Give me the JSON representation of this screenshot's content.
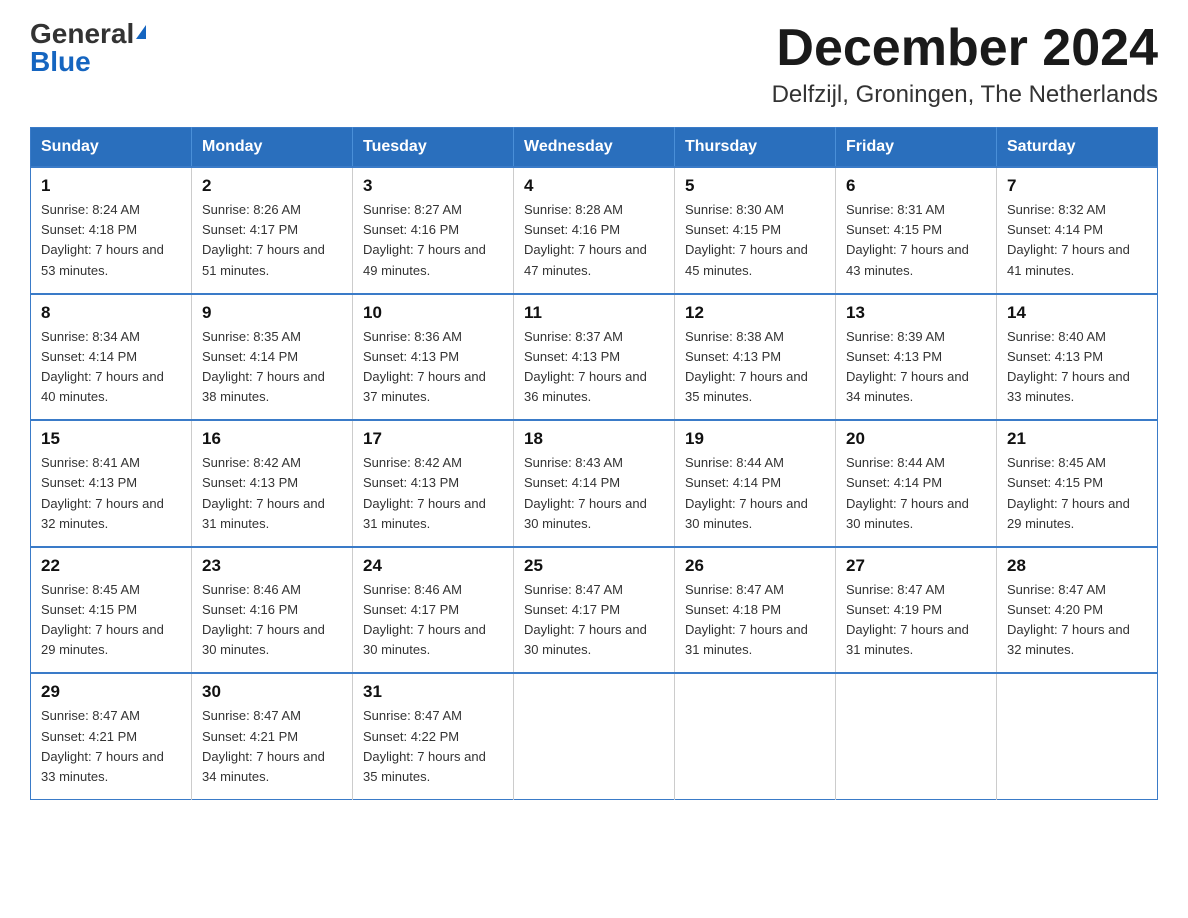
{
  "header": {
    "logo_general": "General",
    "logo_blue": "Blue",
    "month_title": "December 2024",
    "location": "Delfzijl, Groningen, The Netherlands"
  },
  "weekdays": [
    "Sunday",
    "Monday",
    "Tuesday",
    "Wednesday",
    "Thursday",
    "Friday",
    "Saturday"
  ],
  "weeks": [
    [
      {
        "day": "1",
        "sunrise": "8:24 AM",
        "sunset": "4:18 PM",
        "daylight": "7 hours and 53 minutes."
      },
      {
        "day": "2",
        "sunrise": "8:26 AM",
        "sunset": "4:17 PM",
        "daylight": "7 hours and 51 minutes."
      },
      {
        "day": "3",
        "sunrise": "8:27 AM",
        "sunset": "4:16 PM",
        "daylight": "7 hours and 49 minutes."
      },
      {
        "day": "4",
        "sunrise": "8:28 AM",
        "sunset": "4:16 PM",
        "daylight": "7 hours and 47 minutes."
      },
      {
        "day": "5",
        "sunrise": "8:30 AM",
        "sunset": "4:15 PM",
        "daylight": "7 hours and 45 minutes."
      },
      {
        "day": "6",
        "sunrise": "8:31 AM",
        "sunset": "4:15 PM",
        "daylight": "7 hours and 43 minutes."
      },
      {
        "day": "7",
        "sunrise": "8:32 AM",
        "sunset": "4:14 PM",
        "daylight": "7 hours and 41 minutes."
      }
    ],
    [
      {
        "day": "8",
        "sunrise": "8:34 AM",
        "sunset": "4:14 PM",
        "daylight": "7 hours and 40 minutes."
      },
      {
        "day": "9",
        "sunrise": "8:35 AM",
        "sunset": "4:14 PM",
        "daylight": "7 hours and 38 minutes."
      },
      {
        "day": "10",
        "sunrise": "8:36 AM",
        "sunset": "4:13 PM",
        "daylight": "7 hours and 37 minutes."
      },
      {
        "day": "11",
        "sunrise": "8:37 AM",
        "sunset": "4:13 PM",
        "daylight": "7 hours and 36 minutes."
      },
      {
        "day": "12",
        "sunrise": "8:38 AM",
        "sunset": "4:13 PM",
        "daylight": "7 hours and 35 minutes."
      },
      {
        "day": "13",
        "sunrise": "8:39 AM",
        "sunset": "4:13 PM",
        "daylight": "7 hours and 34 minutes."
      },
      {
        "day": "14",
        "sunrise": "8:40 AM",
        "sunset": "4:13 PM",
        "daylight": "7 hours and 33 minutes."
      }
    ],
    [
      {
        "day": "15",
        "sunrise": "8:41 AM",
        "sunset": "4:13 PM",
        "daylight": "7 hours and 32 minutes."
      },
      {
        "day": "16",
        "sunrise": "8:42 AM",
        "sunset": "4:13 PM",
        "daylight": "7 hours and 31 minutes."
      },
      {
        "day": "17",
        "sunrise": "8:42 AM",
        "sunset": "4:13 PM",
        "daylight": "7 hours and 31 minutes."
      },
      {
        "day": "18",
        "sunrise": "8:43 AM",
        "sunset": "4:14 PM",
        "daylight": "7 hours and 30 minutes."
      },
      {
        "day": "19",
        "sunrise": "8:44 AM",
        "sunset": "4:14 PM",
        "daylight": "7 hours and 30 minutes."
      },
      {
        "day": "20",
        "sunrise": "8:44 AM",
        "sunset": "4:14 PM",
        "daylight": "7 hours and 30 minutes."
      },
      {
        "day": "21",
        "sunrise": "8:45 AM",
        "sunset": "4:15 PM",
        "daylight": "7 hours and 29 minutes."
      }
    ],
    [
      {
        "day": "22",
        "sunrise": "8:45 AM",
        "sunset": "4:15 PM",
        "daylight": "7 hours and 29 minutes."
      },
      {
        "day": "23",
        "sunrise": "8:46 AM",
        "sunset": "4:16 PM",
        "daylight": "7 hours and 30 minutes."
      },
      {
        "day": "24",
        "sunrise": "8:46 AM",
        "sunset": "4:17 PM",
        "daylight": "7 hours and 30 minutes."
      },
      {
        "day": "25",
        "sunrise": "8:47 AM",
        "sunset": "4:17 PM",
        "daylight": "7 hours and 30 minutes."
      },
      {
        "day": "26",
        "sunrise": "8:47 AM",
        "sunset": "4:18 PM",
        "daylight": "7 hours and 31 minutes."
      },
      {
        "day": "27",
        "sunrise": "8:47 AM",
        "sunset": "4:19 PM",
        "daylight": "7 hours and 31 minutes."
      },
      {
        "day": "28",
        "sunrise": "8:47 AM",
        "sunset": "4:20 PM",
        "daylight": "7 hours and 32 minutes."
      }
    ],
    [
      {
        "day": "29",
        "sunrise": "8:47 AM",
        "sunset": "4:21 PM",
        "daylight": "7 hours and 33 minutes."
      },
      {
        "day": "30",
        "sunrise": "8:47 AM",
        "sunset": "4:21 PM",
        "daylight": "7 hours and 34 minutes."
      },
      {
        "day": "31",
        "sunrise": "8:47 AM",
        "sunset": "4:22 PM",
        "daylight": "7 hours and 35 minutes."
      },
      null,
      null,
      null,
      null
    ]
  ]
}
